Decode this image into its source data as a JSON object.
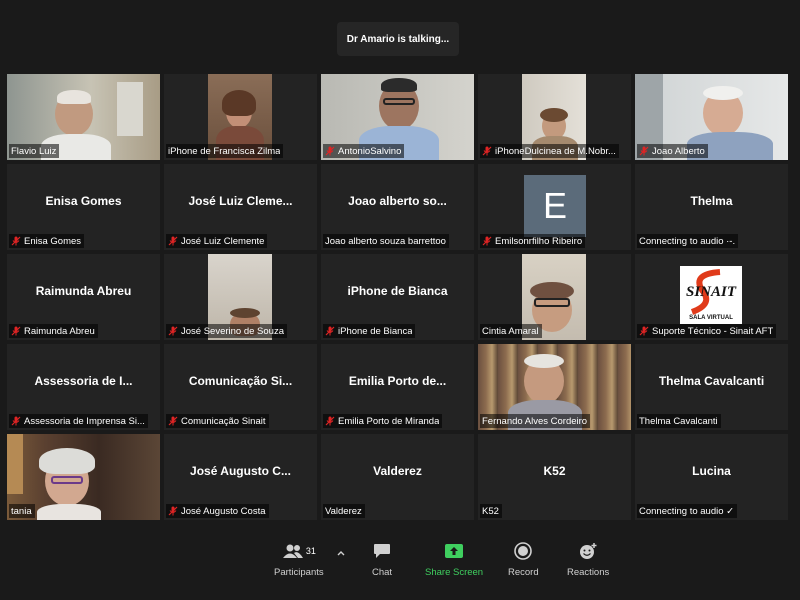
{
  "talking_indicator": "Dr Amario is talking...",
  "tiles": [
    {
      "label": "Flavio Luiz",
      "display": "",
      "muted": false
    },
    {
      "label": "iPhone de Francisca Zilma",
      "display": "",
      "muted": false
    },
    {
      "label": "AntonioSalvino",
      "display": "",
      "muted": true
    },
    {
      "label": "iPhoneDulcinea de M.Nobr...",
      "display": "",
      "muted": true
    },
    {
      "label": "Joao Alberto",
      "display": "",
      "muted": true
    },
    {
      "label": "Enisa Gomes",
      "display": "Enisa Gomes",
      "muted": true
    },
    {
      "label": "José Luiz Clemente",
      "display": "José Luiz Cleme...",
      "muted": true
    },
    {
      "label": "Joao alberto souza barrettoo",
      "display": "Joao alberto so...",
      "muted": false
    },
    {
      "label": "Emilsonrfilho Ribeiro",
      "display": "",
      "avatar_letter": "E",
      "muted": true
    },
    {
      "label": "Connecting to audio ·-.",
      "display": "Thelma",
      "muted": false
    },
    {
      "label": "Raimunda Abreu",
      "display": "Raimunda Abreu",
      "muted": true
    },
    {
      "label": "José Severino de Souza",
      "display": "",
      "muted": true
    },
    {
      "label": "iPhone de Bianca",
      "display": "iPhone de Bianca",
      "muted": true
    },
    {
      "label": "Cintia Amaral",
      "display": "",
      "muted": false
    },
    {
      "label": "Suporte Técnico - Sinait AFT",
      "display": "",
      "logo_text": "SINAIT",
      "logo_sub": "SALA VIRTUAL",
      "muted": true
    },
    {
      "label": "Assessoria de Imprensa Si...",
      "display": "Assessoria de I...",
      "muted": true
    },
    {
      "label": "Comunicação Sinait",
      "display": "Comunicação  Si...",
      "muted": true
    },
    {
      "label": "Emilia Porto de Miranda",
      "display": "Emilia Porto de...",
      "muted": true
    },
    {
      "label": "Fernando Alves Cordeiro",
      "display": "",
      "muted": false
    },
    {
      "label": "Thelma Cavalcanti",
      "display": "Thelma Cavalcanti",
      "muted": false
    },
    {
      "label": "tania",
      "display": "",
      "muted": false
    },
    {
      "label": "José Augusto Costa",
      "display": "José Augusto C...",
      "muted": true
    },
    {
      "label": "Valderez",
      "display": "Valderez",
      "muted": false
    },
    {
      "label": "K52",
      "display": "K52",
      "muted": false
    },
    {
      "label": "Connecting to audio ✓",
      "display": "Lucina",
      "muted": false
    }
  ],
  "toolbar": {
    "participants_label": "Participants",
    "participants_count": "31",
    "chat_label": "Chat",
    "share_label": "Share Screen",
    "record_label": "Record",
    "reactions_label": "Reactions"
  },
  "colors": {
    "background": "#1a1a1a",
    "tile": "#232323",
    "mute_red": "#e02424",
    "share_green": "#3fcf5f",
    "active_speaker": "#2ecc40"
  }
}
